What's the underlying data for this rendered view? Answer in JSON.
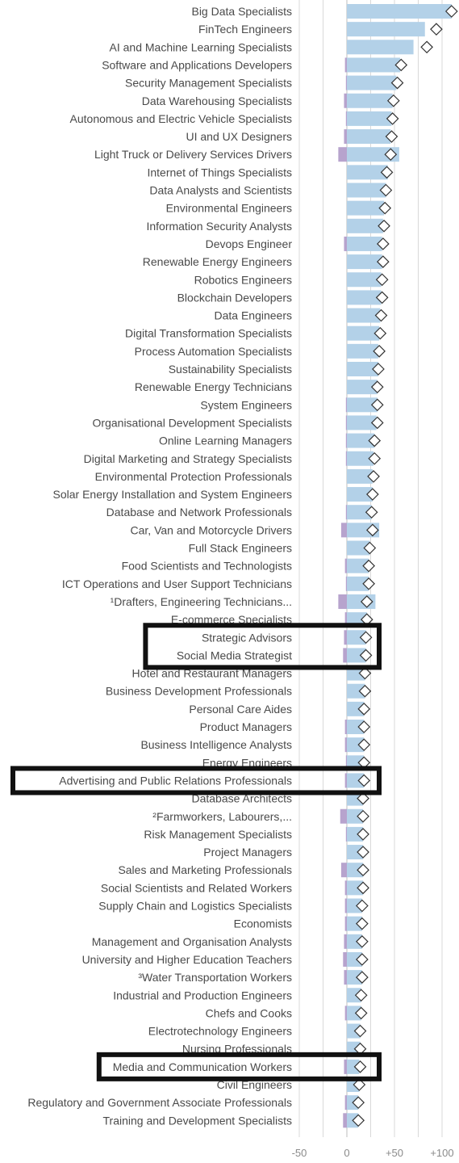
{
  "chart_data": {
    "type": "bar",
    "title": "",
    "xlabel": "",
    "ylabel": "",
    "xlim": [
      -50,
      100
    ],
    "xticks": [
      {
        "value": -50,
        "label": "-50"
      },
      {
        "value": 0,
        "label": "0"
      },
      {
        "value": 50,
        "label": "+50"
      },
      {
        "value": 100,
        "label": "+100"
      }
    ],
    "grid": true,
    "legend": "none",
    "colors": {
      "bar": "#b3d1e8",
      "negative_bar": "#b7a3cd",
      "marker_fill": "#ffffff",
      "marker_stroke": "#333333",
      "highlight_box": "#111111",
      "grid": "#d9d9d9"
    },
    "categories": [
      "Big Data Specialists",
      "FinTech Engineers",
      "AI and Machine Learning Specialists",
      "Software and Applications Developers",
      "Security Management Specialists",
      "Data Warehousing Specialists",
      "Autonomous and Electric Vehicle Specialists",
      "UI and UX Designers",
      "Light Truck or Delivery Services Drivers",
      "Internet of Things Specialists",
      "Data Analysts and Scientists",
      "Environmental Engineers",
      "Information Security Analysts",
      "Devops Engineer",
      "Renewable Energy Engineers",
      "Robotics Engineers",
      "Blockchain Developers",
      "Data Engineers",
      "Digital Transformation Specialists",
      "Process Automation Specialists",
      "Sustainability Specialists",
      "Renewable Energy Technicians",
      "System Engineers",
      "Organisational Development Specialists",
      "Online Learning Managers",
      "Digital Marketing and Strategy Specialists",
      "Environmental Protection Professionals",
      "Solar Energy Installation and System Engineers",
      "Database and Network Professionals",
      "Car, Van and Motorcycle Drivers",
      "Full Stack Engineers",
      "Food Scientists and Technologists",
      "ICT Operations and User Support Technicians",
      "¹Drafters, Engineering Technicians...",
      "E-commerce Specialists",
      "Strategic Advisors",
      "Social Media Strategist",
      "Hotel and Restaurant Managers",
      "Business Development Professionals",
      "Personal Care Aides",
      "Product Managers",
      "Business Intelligence Analysts",
      "Energy Engineers",
      "Advertising and Public Relations Professionals",
      "Database Architects",
      "²Farmworkers, Labourers,...",
      "Risk Management Specialists",
      "Project Managers",
      "Sales and Marketing Professionals",
      "Social Scientists and Related Workers",
      "Supply Chain and Logistics Specialists",
      "Economists",
      "Management and Organisation Analysts",
      "University and Higher Education Teachers",
      "³Water Transportation Workers",
      "Industrial and Production Engineers",
      "Chefs and Cooks",
      "Electrotechnology Engineers",
      "Nursing Professionals",
      "Media and Communication Workers",
      "Civil Engineers",
      "Regulatory and Government Associate Professionals",
      "Training and Development Specialists"
    ],
    "series": [
      {
        "role": "growth",
        "values": [
          110,
          82,
          70,
          56,
          52,
          48,
          47,
          46,
          55,
          43,
          41,
          39,
          38,
          37,
          37,
          36,
          36,
          35,
          34,
          33,
          33,
          32,
          32,
          31,
          29,
          28,
          27,
          27,
          26,
          34,
          24,
          23,
          23,
          30,
          21,
          20,
          20,
          19,
          19,
          18,
          18,
          18,
          18,
          18,
          17,
          17,
          17,
          17,
          17,
          17,
          16,
          16,
          16,
          16,
          16,
          15,
          15,
          14,
          14,
          13,
          13,
          12,
          12
        ]
      },
      {
        "role": "decline",
        "values": [
          0,
          0,
          0,
          -2,
          -1,
          -3,
          -1,
          -3,
          -9,
          0,
          0,
          0,
          0,
          -3,
          0,
          0,
          0,
          0,
          0,
          0,
          0,
          0,
          -1,
          -1,
          -1,
          -1,
          0,
          0,
          -1,
          -6,
          0,
          -2,
          -1,
          -9,
          -2,
          -3,
          -4,
          0,
          0,
          0,
          -2,
          -2,
          -1,
          -2,
          0,
          -7,
          -1,
          0,
          -6,
          -2,
          -2,
          -2,
          -3,
          -4,
          -3,
          0,
          -2,
          0,
          0,
          -3,
          0,
          -2,
          -4
        ]
      },
      {
        "role": "net",
        "values": [
          110,
          94,
          84,
          57,
          53,
          49,
          48,
          47,
          46,
          42,
          41,
          40,
          39,
          38,
          38,
          37,
          37,
          36,
          35,
          34,
          33,
          32,
          32,
          32,
          29,
          29,
          28,
          27,
          26,
          27,
          24,
          23,
          23,
          21,
          21,
          20,
          20,
          19,
          19,
          18,
          18,
          18,
          18,
          18,
          17,
          17,
          17,
          17,
          17,
          17,
          16,
          16,
          16,
          16,
          16,
          15,
          15,
          14,
          14,
          14,
          13,
          12,
          12
        ]
      }
    ],
    "highlighted_categories": [
      "Strategic Advisors",
      "Social Media Strategist",
      "Advertising and Public Relations Professionals",
      "Media and Communication Workers"
    ]
  }
}
